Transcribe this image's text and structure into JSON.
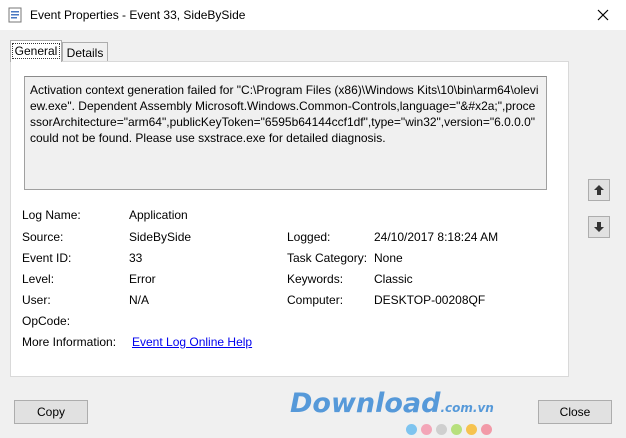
{
  "window": {
    "title": "Event Properties - Event 33, SideBySide",
    "close_glyph": "✕"
  },
  "tabs": [
    {
      "label": "General"
    },
    {
      "label": "Details"
    }
  ],
  "description": "Activation context generation failed for \"C:\\Program Files (x86)\\Windows Kits\\10\\bin\\arm64\\oleview.exe\". Dependent Assembly Microsoft.Windows.Common-Controls,language=\"&#x2a;\",processorArchitecture=\"arm64\",publicKeyToken=\"6595b64144ccf1df\",type=\"win32\",version=\"6.0.0.0\" could not be found. Please use sxstrace.exe for detailed diagnosis.",
  "fields": {
    "log_name_label": "Log Name:",
    "log_name": "Application",
    "source_label": "Source:",
    "source": "SideBySide",
    "logged_label": "Logged:",
    "logged": "24/10/2017 8:18:24 AM",
    "event_id_label": "Event ID:",
    "event_id": "33",
    "task_category_label": "Task Category:",
    "task_category": "None",
    "level_label": "Level:",
    "level": "Error",
    "keywords_label": "Keywords:",
    "keywords": "Classic",
    "user_label": "User:",
    "user": "N/A",
    "computer_label": "Computer:",
    "computer": "DESKTOP-00208QF",
    "opcode_label": "OpCode:",
    "opcode": "",
    "more_info_label": "More Information:",
    "more_info_link": "Event Log Online Help"
  },
  "buttons": {
    "copy": "Copy",
    "close": "Close"
  },
  "watermark": {
    "text": "Download",
    "suffix": ".com.vn"
  }
}
